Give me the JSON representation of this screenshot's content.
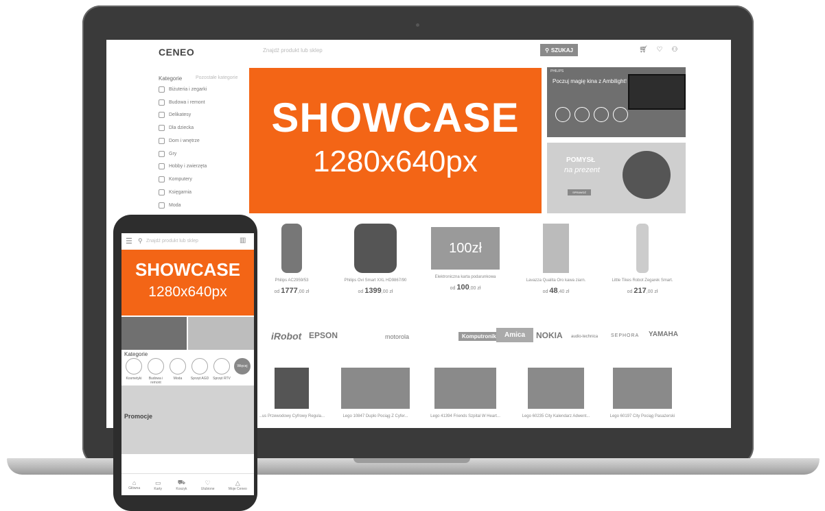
{
  "site": {
    "logo": "CENEO",
    "search_placeholder": "Znajdź produkt lub sklep",
    "search_button": "SZUKAJ",
    "categories_heading": "Kategorie",
    "categories_other": "Pozostałe kategorie",
    "categories": [
      "Biżuteria i zegarki",
      "Budowa i remont",
      "Delikatesy",
      "Dla dziecka",
      "Dom i wnętrze",
      "Gry",
      "Hobby i zwierzęta",
      "Komputery",
      "Księgarnia",
      "Moda"
    ]
  },
  "showcase": {
    "title": "SHOWCASE",
    "size": "1280x640px"
  },
  "banners": {
    "philips_brand": "PHILIPS",
    "philips_title": "Poczuj magię kina z Ambilight!",
    "gift_title": "POMYSŁ",
    "gift_sub": "na prezent",
    "gift_button": "SPRAWDŹ"
  },
  "products": [
    {
      "name": "Philips AC2959/53",
      "from": "od",
      "price": "1777",
      "cents": ",00 zł"
    },
    {
      "name": "Philips Ovi Smart XXL HD9867/90",
      "from": "od",
      "price": "1399",
      "cents": ",00 zł"
    },
    {
      "name": "Elektroniczna karta podarunkowa",
      "from": "od",
      "price": "100",
      "cents": ",00 zł",
      "card_label": "100zł"
    },
    {
      "name": "Lavazza Qualita Oro kawa ziarn.",
      "from": "od",
      "price": "48",
      "cents": ",40 zł"
    },
    {
      "name": "Little Tikes Robot Zegarek Smart.",
      "from": "od",
      "price": "217",
      "cents": ",00 zł"
    }
  ],
  "brands": [
    "iRobot",
    "EPSON",
    "motorola",
    "Komputronik",
    "Amica",
    "NOKIA",
    "audio-technica",
    "SEPHORA",
    "YAMAHA"
  ],
  "products_row2": [
    "...us Przewodowy Cyfrowy Regula...",
    "Lego 10847 Duplo Pociąg Z Cyfer...",
    "Lego 41394 Friends Szpital W Heart...",
    "Lego 60235 City Kalendarz Adwent...",
    "Lego 60197 City Pociąg Pasażerski"
  ],
  "mobile": {
    "search_placeholder": "Znajdź produkt lub sklep",
    "showcase_title": "SHOWCASE",
    "showcase_size": "1280x640px",
    "categories_heading": "Kategorie",
    "categories": [
      "Kosmetyki",
      "Budowa i remont",
      "Moda",
      "Sprzęt AGD",
      "Sprzęt RTV"
    ],
    "more_label": "Więcej",
    "promo_label": "Promocje",
    "nav": [
      "Główna",
      "Karty",
      "Koszyk",
      "Ulubione",
      "Moje Ceneo"
    ]
  }
}
